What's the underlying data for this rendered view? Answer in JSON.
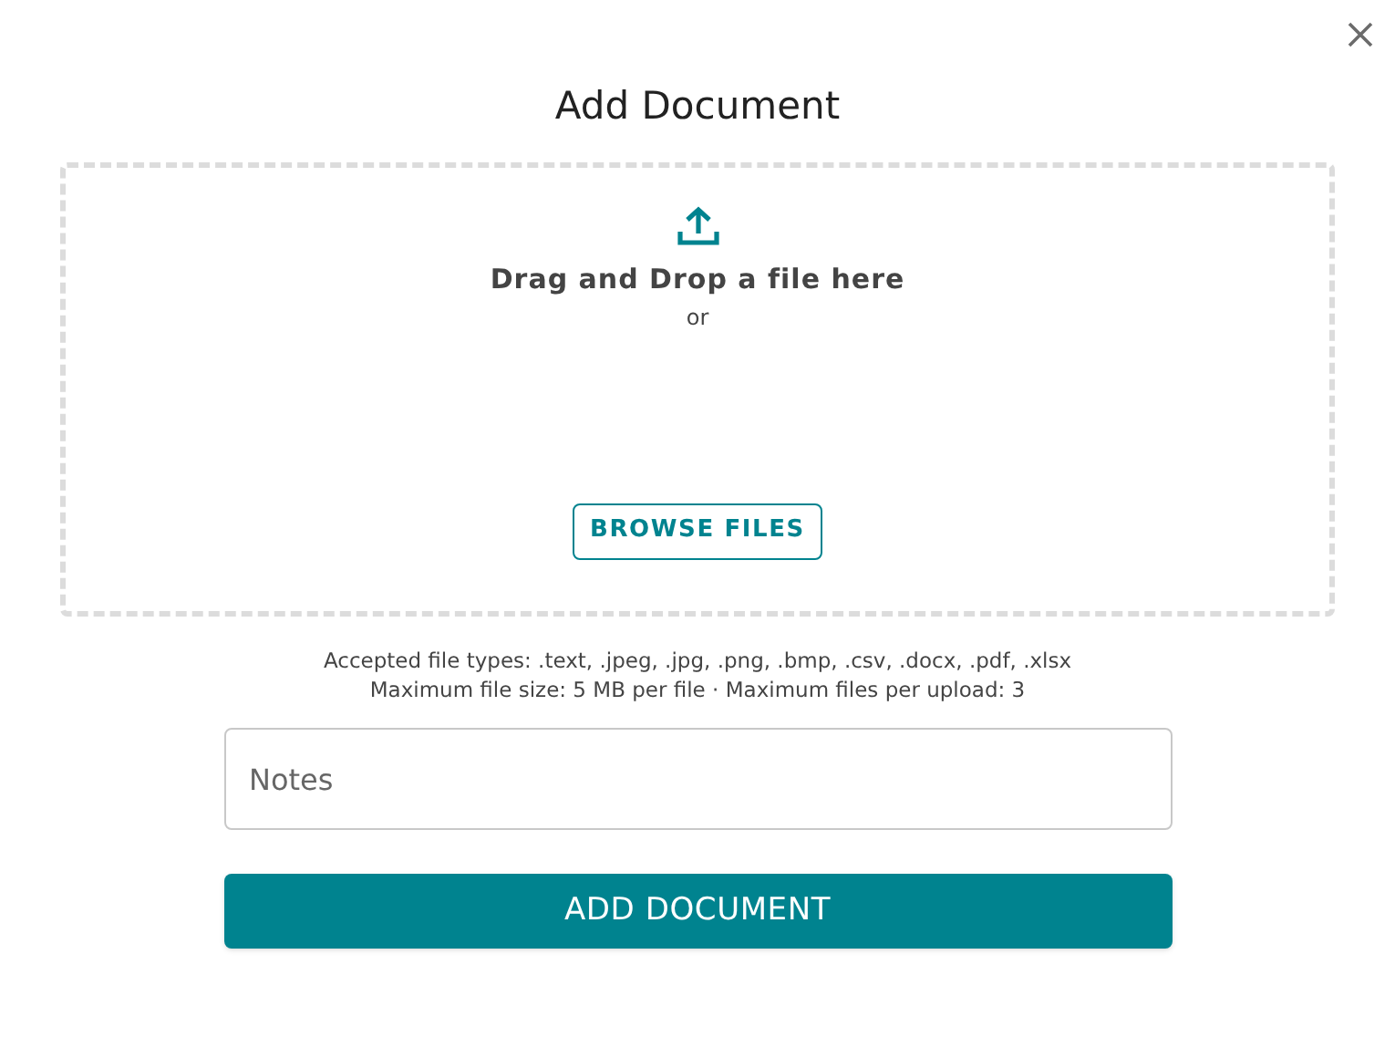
{
  "dialog": {
    "title": "Add Document"
  },
  "dropzone": {
    "prompt": "Drag and Drop a file here",
    "separator": "or",
    "browse_button": "BROWSE FILES"
  },
  "info": [
    "Accepted file types: .text, .jpeg, .jpg, .png, .bmp, .csv, .docx, .pdf, .xlsx",
    "Maximum file size: 5 MB per file · Maximum files per upload: 3"
  ],
  "notes": {
    "placeholder": "Notes"
  },
  "submit_button": "ADD DOCUMENT"
}
